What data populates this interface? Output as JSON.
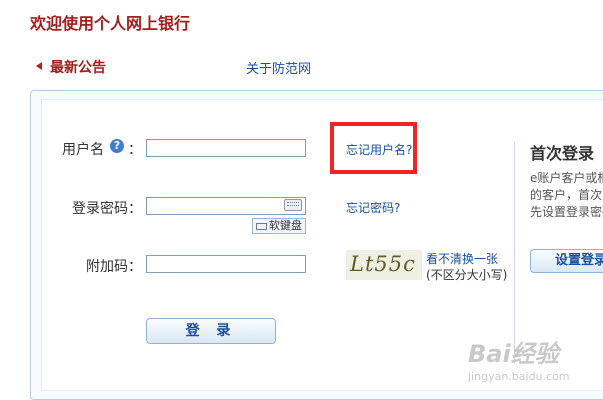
{
  "header": {
    "title": "欢迎使用个人网上银行"
  },
  "notice": {
    "title": "最新公告",
    "link": "关于防范网"
  },
  "form": {
    "username": {
      "label": "用户名",
      "colon": "：",
      "value": "",
      "placeholder": ""
    },
    "password": {
      "label": "登录密码：",
      "value": "",
      "placeholder": "",
      "soft_keyboard": "软键盘"
    },
    "captcha": {
      "label": "附加码：",
      "value": "",
      "placeholder": "",
      "image_text": "Lt55c",
      "refresh": "看不清换一张",
      "case_hint": "(不区分大小写)"
    },
    "help_icon": "?",
    "forgot_username": "忘记用户名?",
    "forgot_password": "忘记密码?",
    "login_button": "登 录"
  },
  "first_login": {
    "title": "首次登录",
    "desc_lines": [
      "e账户客户或柜",
      "的客户，首次",
      "先设置登录密码"
    ],
    "button": "设置登录"
  },
  "watermark": {
    "logo": "Bai经验",
    "sub": "jingyan.baidu.com"
  },
  "colors": {
    "title_red": "#a61c1c",
    "link_blue": "#1a4e9f",
    "highlight": "#f02424"
  }
}
